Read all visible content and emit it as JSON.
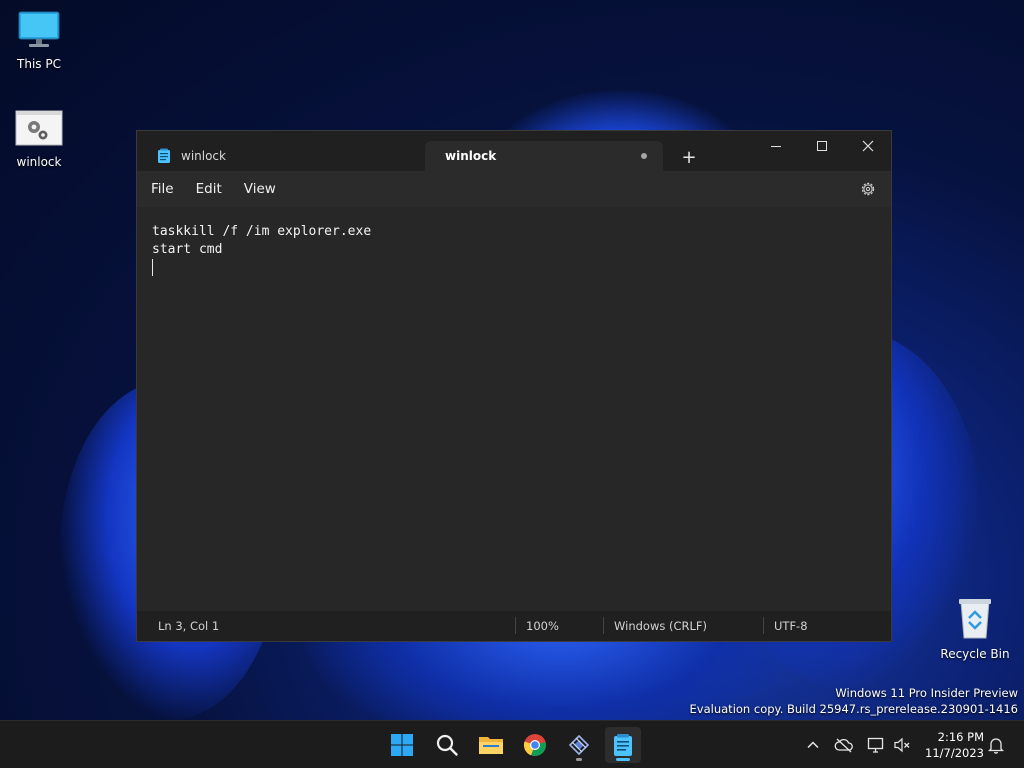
{
  "desktop": {
    "icons": [
      {
        "label": "This PC",
        "icon": "monitor-icon"
      },
      {
        "label": "winlock",
        "icon": "settings-file-icon"
      },
      {
        "label": "Recycle Bin",
        "icon": "recycle-bin-icon"
      }
    ],
    "watermark": {
      "line1": "Windows 11 Pro Insider Preview",
      "line2": "Evaluation copy. Build 25947.rs_prerelease.230901-1416"
    }
  },
  "notepad": {
    "tabs": [
      {
        "title": "winlock",
        "active": false
      },
      {
        "title": "winlock",
        "active": true,
        "modified": true
      }
    ],
    "new_tab_label": "+",
    "menu": {
      "file": "File",
      "edit": "Edit",
      "view": "View"
    },
    "content": {
      "lines": [
        "taskkill /f /im explorer.exe",
        "start cmd",
        ""
      ]
    },
    "status": {
      "position": "Ln 3, Col 1",
      "zoom": "100%",
      "line_ending": "Windows (CRLF)",
      "encoding": "UTF-8"
    }
  },
  "taskbar": {
    "apps": [
      "start-icon",
      "search-icon",
      "file-explorer-icon",
      "chrome-icon",
      "app-icon",
      "notepad-icon"
    ],
    "tray": [
      "chevron-up-icon",
      "cloud-offline-icon",
      "network-icon",
      "volume-muted-icon",
      "bell-icon"
    ],
    "clock": {
      "time": "2:16 PM",
      "date": "11/7/2023"
    }
  },
  "colors": {
    "accent": "#4cc2ff",
    "window_bg": "#272727",
    "titlebar_bg": "#202020"
  }
}
